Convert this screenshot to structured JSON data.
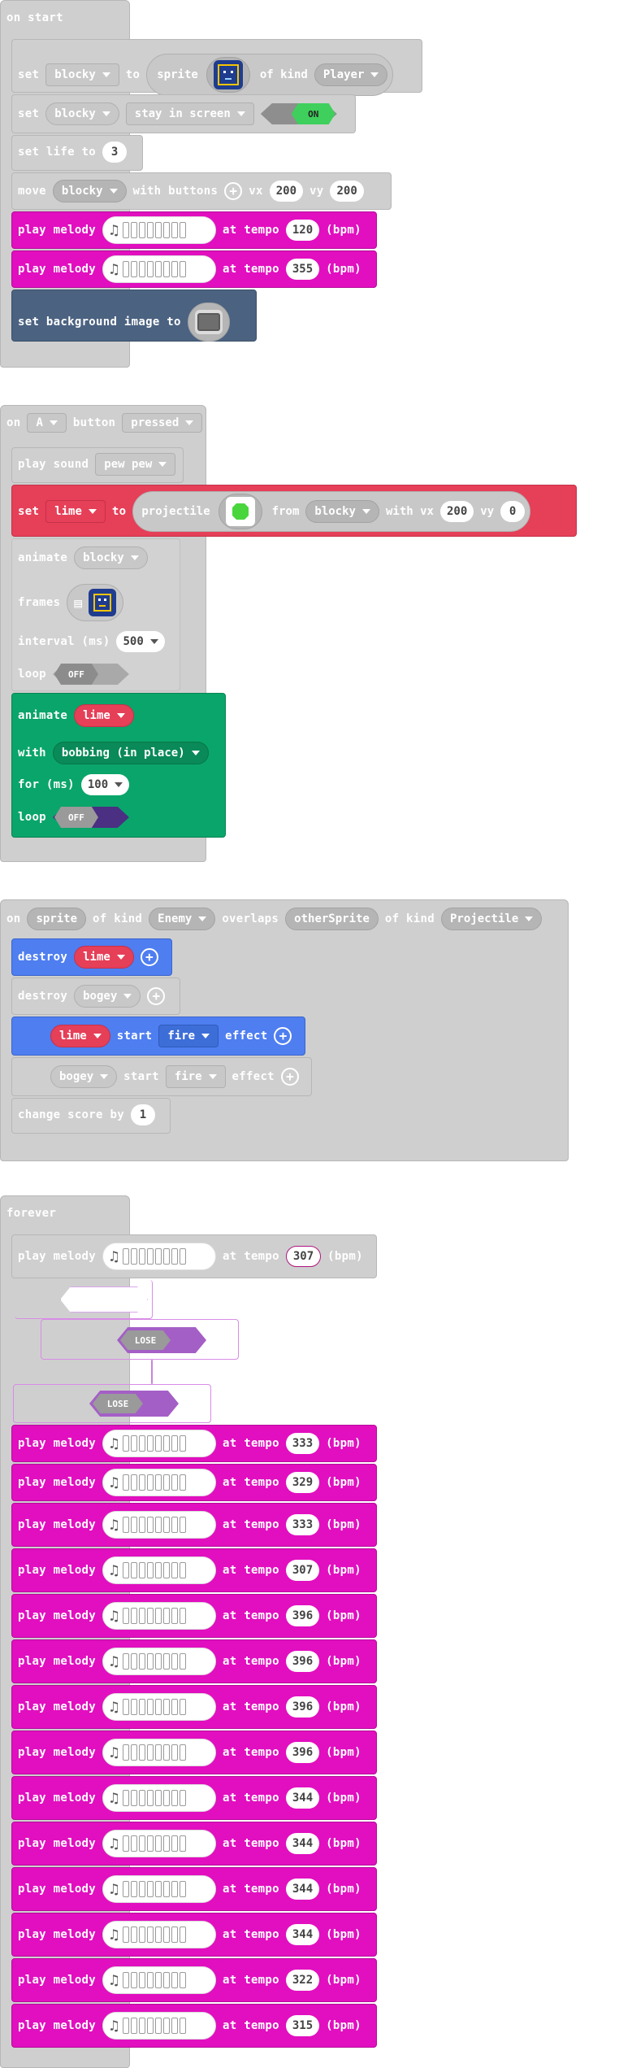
{
  "on_start": {
    "header": "on start",
    "set_sprite": {
      "set": "set",
      "var": "blocky",
      "to": "to",
      "sprite": "sprite",
      "of_kind": "of kind",
      "kind": "Player"
    },
    "stay": {
      "set": "set",
      "var": "blocky",
      "option": "stay in screen",
      "toggle": "ON"
    },
    "life": {
      "label": "set life to",
      "value": "3"
    },
    "move": {
      "move": "move",
      "var": "blocky",
      "with_buttons": "with buttons",
      "vx": "vx",
      "vx_val": "200",
      "vy": "vy",
      "vy_val": "200"
    },
    "melody1": {
      "play": "play melody",
      "at": "at tempo",
      "tempo": "120",
      "unit": "(bpm)"
    },
    "melody2": {
      "play": "play melody",
      "at": "at tempo",
      "tempo": "355",
      "unit": "(bpm)"
    },
    "bg": {
      "label": "set background image to"
    }
  },
  "on_button": {
    "on": "on",
    "button": "A",
    "button_label": "button",
    "event": "pressed",
    "sound": {
      "label": "play sound",
      "value": "pew pew"
    },
    "projectile": {
      "set": "set",
      "var": "lime",
      "to": "to",
      "projectile": "projectile",
      "from": "from",
      "from_var": "blocky",
      "with_vx": "with vx",
      "vx_val": "200",
      "vy": "vy",
      "vy_val": "0"
    },
    "animate": {
      "label": "animate",
      "var": "blocky",
      "frames": "frames",
      "interval": "interval (ms)",
      "interval_val": "500",
      "loop": "loop",
      "loop_val": "OFF"
    },
    "animate2": {
      "label": "animate",
      "var": "lime",
      "with": "with",
      "effect": "bobbing (in place)",
      "for": "for (ms)",
      "for_val": "100",
      "loop": "loop",
      "loop_val": "OFF"
    }
  },
  "overlap": {
    "on": "on",
    "sprite": "sprite",
    "of_kind": "of kind",
    "kind1": "Enemy",
    "overlaps": "overlaps",
    "other": "otherSprite",
    "of_kind2": "of kind",
    "kind2": "Projectile",
    "destroy1": {
      "label": "destroy",
      "var": "lime"
    },
    "destroy2": {
      "label": "destroy",
      "var": "bogey"
    },
    "effect1": {
      "var": "lime",
      "start": "start",
      "effect": "fire",
      "label": "effect"
    },
    "effect2": {
      "var": "bogey",
      "start": "start",
      "effect": "fire",
      "label": "effect"
    },
    "score": {
      "label": "change score by",
      "value": "1"
    }
  },
  "forever": {
    "header": "forever",
    "melody_label": "play melody",
    "at_label": "at tempo",
    "unit": "(bpm)",
    "first_tempo": "307",
    "lose1": "LOSE",
    "lose2": "LOSE",
    "tempos": [
      "333",
      "329",
      "333",
      "307",
      "396",
      "396",
      "396",
      "396",
      "344",
      "344",
      "344",
      "344",
      "322",
      "315"
    ]
  },
  "colors": {
    "music": "#e10fbf",
    "scene": "#4b6281",
    "sprites": "#e63f58",
    "animation": "#0aa56a",
    "effects": "#4e7ef0",
    "disabled": "#cfcfcf"
  }
}
